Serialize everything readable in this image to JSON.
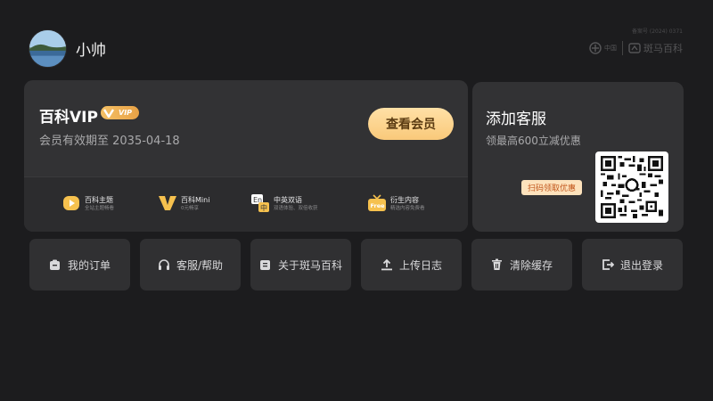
{
  "header": {
    "username": "小帅",
    "record_number": "备案号 (2024) 0371",
    "brand_left": "中国",
    "brand_right": "斑马百科"
  },
  "vip": {
    "title": "百科VIP",
    "badge": "VIP",
    "expire_text": "会员有效期至 2035-04-18",
    "view_button": "查看会员",
    "perks": [
      {
        "title": "百科主题",
        "subtitle": "全站主题畅看",
        "icon": "play-icon"
      },
      {
        "title": "百科Mini",
        "subtitle": "0元畅享",
        "icon": "v-logo-icon"
      },
      {
        "title": "中英双语",
        "subtitle": "双语体验、双倍收获",
        "icon": "en-zh-icon"
      },
      {
        "title": "衍生内容",
        "subtitle": "精选内容免费看",
        "icon": "free-icon"
      }
    ]
  },
  "service": {
    "title": "添加客服",
    "subtitle": "领最高600立减优惠",
    "scan_tag": "扫码领取优惠"
  },
  "actions": [
    {
      "label": "我的订单",
      "icon": "order-icon"
    },
    {
      "label": "客服/帮助",
      "icon": "headset-icon"
    },
    {
      "label": "关于斑马百科",
      "icon": "info-doc-icon"
    },
    {
      "label": "上传日志",
      "icon": "upload-icon"
    },
    {
      "label": "清除缓存",
      "icon": "trash-icon"
    },
    {
      "label": "退出登录",
      "icon": "logout-icon"
    }
  ],
  "colors": {
    "background": "#1c1c1e",
    "card": "#323234",
    "button_gold": "#f9c97a",
    "badge_gold": "#e8a246"
  }
}
